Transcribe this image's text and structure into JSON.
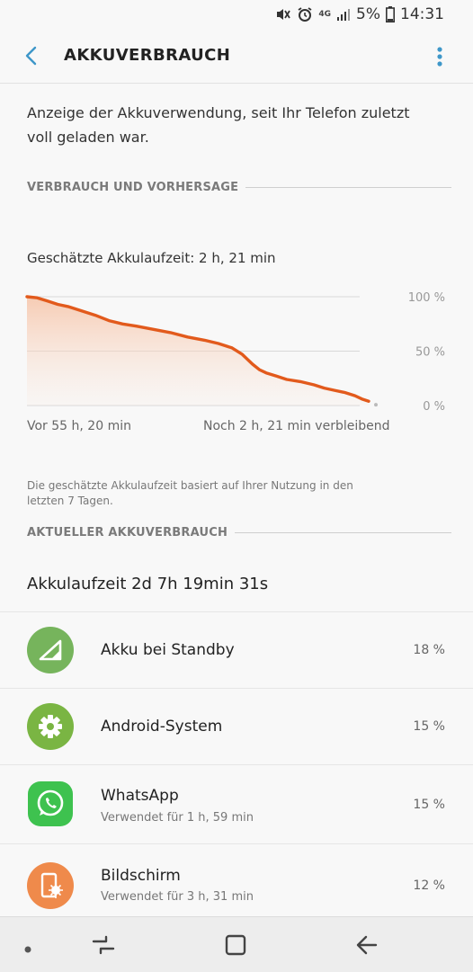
{
  "status_bar": {
    "network": "4G",
    "battery_percent": "5%",
    "time": "14:31"
  },
  "app_bar": {
    "title": "AKKUVERBRAUCH"
  },
  "description": "Anzeige der Akkuverwendung, seit Ihr Telefon zuletzt voll geladen war.",
  "section_usage": "VERBRAUCH UND VORHERSAGE",
  "estimate_label": "Geschätzte Akkulaufzeit: 2 h, 21 min",
  "chart_data": {
    "type": "area",
    "y_ticks": [
      "100 %",
      "50 %",
      "0 %"
    ],
    "x_labels": [
      "Vor 55 h, 20 min",
      "Noch 2 h, 21 min verbleibend"
    ],
    "ylim": [
      0,
      100
    ],
    "x": [
      0,
      0.03,
      0.06,
      0.09,
      0.12,
      0.16,
      0.2,
      0.24,
      0.28,
      0.32,
      0.37,
      0.42,
      0.47,
      0.52,
      0.56,
      0.6,
      0.63,
      0.66,
      0.68,
      0.7,
      0.73,
      0.76,
      0.8,
      0.84,
      0.87,
      0.9,
      0.93,
      0.96,
      0.98,
      1
    ],
    "values": [
      100,
      99,
      96,
      93,
      91,
      87,
      83,
      78,
      75,
      73,
      70,
      67,
      63,
      60,
      57,
      53,
      47,
      38,
      33,
      30,
      27,
      24,
      22,
      19,
      16,
      14,
      12,
      9,
      6,
      4
    ],
    "color": "#e25a1c"
  },
  "prediction_note": "Die geschätzte Akkulaufzeit basiert auf Ihrer Nutzung in den letzten 7 Tagen.",
  "section_current": "AKTUELLER AKKUVERBRAUCH",
  "uptime": "Akkulaufzeit 2d 7h 19min 31s",
  "items": [
    {
      "name": "Akku bei Standby",
      "sub": "",
      "percent": "18 %",
      "icon": "cell-signal-icon",
      "color": "#76b45c"
    },
    {
      "name": "Android-System",
      "sub": "",
      "percent": "15 %",
      "icon": "gear-icon",
      "color": "#7ab543"
    },
    {
      "name": "WhatsApp",
      "sub": "Verwendet für 1 h, 59 min",
      "percent": "15 %",
      "icon": "whatsapp-icon",
      "color": "#3ec24f"
    },
    {
      "name": "Bildschirm",
      "sub": "Verwendet für 3 h, 31 min",
      "percent": "12 %",
      "icon": "screen-brightness-icon",
      "color": "#ef8a4b"
    }
  ]
}
